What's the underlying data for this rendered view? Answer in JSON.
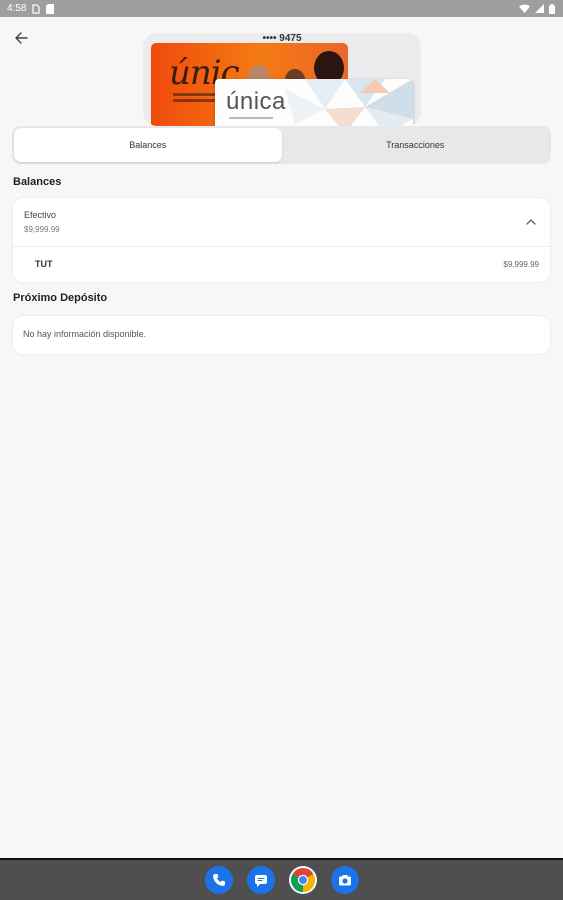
{
  "status_bar": {
    "time": "4:58",
    "icons": [
      "sim-icon",
      "sd-card-icon",
      "wifi-icon",
      "signal-icon",
      "battery-icon"
    ]
  },
  "header": {
    "back_icon": "arrow-back-icon"
  },
  "card": {
    "number": "•••• 9475",
    "front_brand": "únic",
    "back_brand": "única"
  },
  "tabs": [
    {
      "label": "Balances",
      "active": true
    },
    {
      "label": "Transacciones",
      "active": false
    }
  ],
  "balances": {
    "title": "Balances",
    "account_name": "Efectivo",
    "account_amount": "$9,999.99",
    "rows": [
      {
        "label": "TUT",
        "value": "$9,999.99"
      }
    ]
  },
  "deposit": {
    "title": "Próximo Depósito",
    "empty_text": "No hay información disponible."
  },
  "dock": {
    "apps": [
      "phone-icon",
      "messages-icon",
      "chrome-icon",
      "camera-icon"
    ]
  },
  "colors": {
    "status_bar": "#9e9e9e",
    "background": "#f7f7f8",
    "card_orange": "#f47a12",
    "nav_bar": "#4f4f4f",
    "dock_blue": "#1a73e8"
  }
}
